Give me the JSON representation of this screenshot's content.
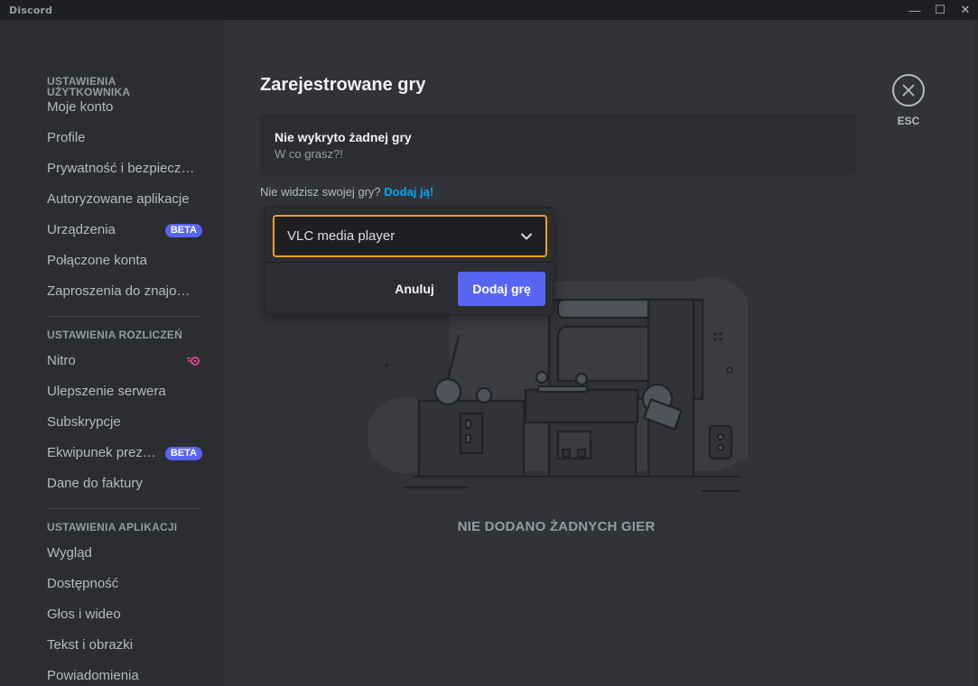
{
  "window": {
    "title": "Discord",
    "controls": {
      "minimize": "—",
      "maximize": "☐",
      "close": "✕"
    }
  },
  "sidebar": {
    "sections": [
      {
        "header": "USTAWIENIA UŻYTKOWNIKA",
        "items": [
          {
            "label": "Moje konto"
          },
          {
            "label": "Profile"
          },
          {
            "label": "Prywatność i bezpieczeństwo"
          },
          {
            "label": "Autoryzowane aplikacje"
          },
          {
            "label": "Urządzenia",
            "badge": "BETA"
          },
          {
            "label": "Połączone konta"
          },
          {
            "label": "Zaproszenia do znajomych"
          }
        ]
      },
      {
        "header": "USTAWIENIA ROZLICZEŃ",
        "items": [
          {
            "label": "Nitro",
            "icon": "nitro-icon"
          },
          {
            "label": "Ulepszenie serwera"
          },
          {
            "label": "Subskrypcje"
          },
          {
            "label": "Ekwipunek prezentów",
            "badge": "BETA"
          },
          {
            "label": "Dane do faktury"
          }
        ]
      },
      {
        "header": "USTAWIENIA APLIKACJI",
        "items": [
          {
            "label": "Wygląd"
          },
          {
            "label": "Dostępność"
          },
          {
            "label": "Głos i wideo"
          },
          {
            "label": "Tekst i obrazki"
          },
          {
            "label": "Powiadomienia"
          }
        ]
      }
    ]
  },
  "main": {
    "title": "Zarejestrowane gry",
    "status_card": {
      "title": "Nie wykryto żadnej gry",
      "subtitle": "W co grasz?!"
    },
    "hint": {
      "text": "Nie widzisz swojej gry?",
      "link": "Dodaj ją!"
    },
    "close": {
      "label": "ESC",
      "icon": "close-icon"
    },
    "empty_state": "NIE DODANO ŻADNYCH GIER"
  },
  "popup": {
    "selected_game": "VLC media player",
    "cancel_label": "Anuluj",
    "add_label": "Dodaj grę"
  },
  "colors": {
    "accent": "#5865f2",
    "focus_border": "#f0a020",
    "link": "#00a8fc",
    "background": "#313338",
    "sidebar": "#2b2d31"
  }
}
